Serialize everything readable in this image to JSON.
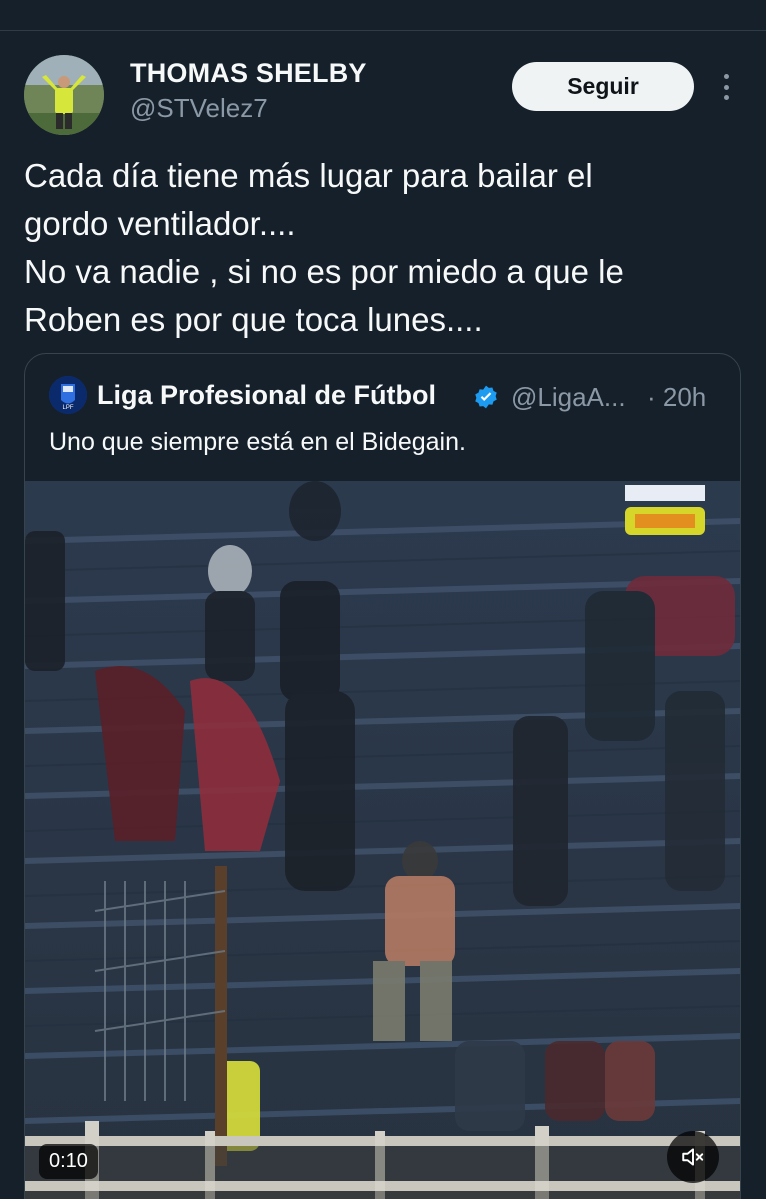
{
  "tweet": {
    "author": {
      "display_name": "THOMAS SHELBY",
      "handle": "@STVelez7"
    },
    "follow_label": "Seguir",
    "text_lines": [
      "Cada día tiene más lugar para bailar el",
      "gordo ventilador....",
      "No va nadie , si no es por miedo a que le",
      "Roben es por que toca lunes...."
    ]
  },
  "quoted_tweet": {
    "display_name": "Liga Profesional de Fútbol",
    "handle": "@LigaA...",
    "time": "· 20h",
    "text": "Uno que siempre está en el Bidegain.",
    "video": {
      "duration": "0:10"
    }
  },
  "icons": {
    "more": "more-options-icon",
    "verified": "verified-badge-icon",
    "mute": "volume-muted-icon"
  },
  "colors": {
    "background": "#15202b",
    "text_primary": "#f7f9f9",
    "text_secondary": "#8b98a5",
    "verified": "#1d9bf0",
    "follow_button_bg": "#eff3f4"
  }
}
